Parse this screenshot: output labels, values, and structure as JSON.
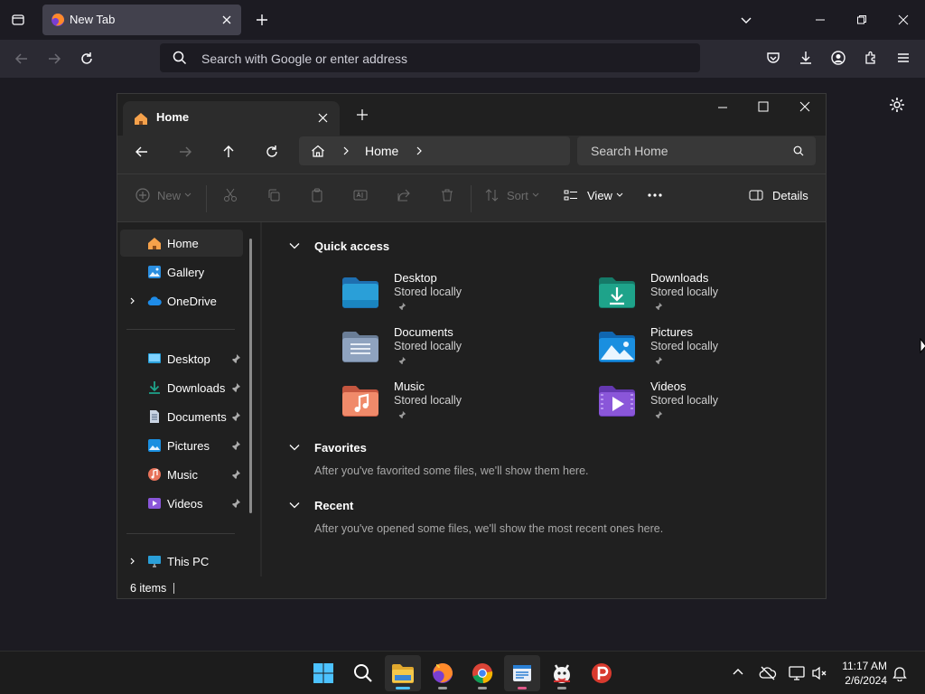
{
  "browser": {
    "tab_title": "New Tab",
    "url_placeholder": "Search with Google or enter address"
  },
  "explorer": {
    "tab_title": "Home",
    "breadcrumb": "Home",
    "search_placeholder": "Search Home",
    "commands": {
      "new": "New",
      "sort": "Sort",
      "view": "View",
      "details": "Details"
    },
    "sidebar": {
      "top": [
        {
          "label": "Home",
          "icon": "home-icon"
        },
        {
          "label": "Gallery",
          "icon": "gallery-icon"
        },
        {
          "label": "OneDrive",
          "icon": "onedrive-icon"
        }
      ],
      "pinned": [
        {
          "label": "Desktop",
          "icon": "desktop-folder-icon"
        },
        {
          "label": "Downloads",
          "icon": "downloads-folder-icon"
        },
        {
          "label": "Documents",
          "icon": "documents-folder-icon"
        },
        {
          "label": "Pictures",
          "icon": "pictures-folder-icon"
        },
        {
          "label": "Music",
          "icon": "music-folder-icon"
        },
        {
          "label": "Videos",
          "icon": "videos-folder-icon"
        }
      ],
      "this_pc": "This PC"
    },
    "sections": {
      "quick_access": "Quick access",
      "favorites": "Favorites",
      "favorites_empty": "After you've favorited some files, we'll show them here.",
      "recent": "Recent",
      "recent_empty": "After you've opened some files, we'll show the most recent ones here."
    },
    "quick_access": [
      {
        "name": "Desktop",
        "sub": "Stored locally",
        "color": "#2a9fd8"
      },
      {
        "name": "Downloads",
        "sub": "Stored locally",
        "color": "#1ea38a"
      },
      {
        "name": "Documents",
        "sub": "Stored locally",
        "color": "#8fa3bf"
      },
      {
        "name": "Pictures",
        "sub": "Stored locally",
        "color": "#1a8fe0"
      },
      {
        "name": "Music",
        "sub": "Stored locally",
        "color": "#e8735a"
      },
      {
        "name": "Videos",
        "sub": "Stored locally",
        "color": "#8a56d9"
      }
    ],
    "status": "6 items"
  },
  "taskbar": {
    "time": "11:17 AM",
    "date": "2/6/2024",
    "apps": [
      "start-icon",
      "search-icon",
      "file-explorer-icon",
      "firefox-icon",
      "chrome-icon",
      "notepad-icon",
      "psiphon-mascot-icon",
      "psiphon-icon"
    ]
  },
  "colors": {
    "accent": "#4cc2ff",
    "folder_yellow": "#f0c040"
  }
}
